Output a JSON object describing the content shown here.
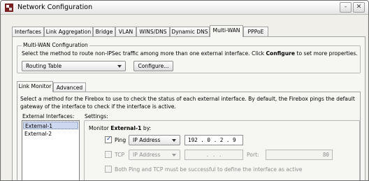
{
  "window": {
    "title": "Network Configuration",
    "controls": {
      "minimize": "-",
      "close": "✕"
    }
  },
  "tabs": [
    {
      "label": "Interfaces"
    },
    {
      "label": "Link Aggregation"
    },
    {
      "label": "Bridge"
    },
    {
      "label": "VLAN"
    },
    {
      "label": "WINS/DNS"
    },
    {
      "label": "Dynamic DNS"
    },
    {
      "label": "Multi-WAN"
    },
    {
      "label": "PPPoE"
    }
  ],
  "active_tab": "Multi-WAN",
  "multiwan": {
    "group_label": "Multi-WAN Configuration",
    "description_pre": "Select the method to route non-IPSec traffic among more than one external interface. Click ",
    "description_bold": "Configure",
    "description_post": " to set more properties.",
    "method_value": "Routing Table",
    "configure_label": "Configure..."
  },
  "subtabs": [
    {
      "label": "Link Monitor"
    },
    {
      "label": "Advanced"
    }
  ],
  "link_monitor": {
    "description": "Select a method for the Firebox to use to check the status of each external interface. By default, the Firebox pings the default",
    "description2": "gateway of the interface to check if the interface is active.",
    "interfaces_label": "External Interfaces:",
    "interfaces": [
      "External-1",
      "External-2"
    ],
    "selected_interface": "External-1",
    "settings_label": "Settings:",
    "monitor_prefix": "Monitor ",
    "monitor_bold": "External-1",
    "monitor_suffix": " by:",
    "ping": {
      "label": "Ping",
      "checked": true,
      "type": "IP Address",
      "value": "192 . 0 . 2 . 9"
    },
    "tcp": {
      "label": "TCP",
      "checked": false,
      "type": "IP Address",
      "value": ". . .",
      "port_label": "Port:",
      "port_value": "80"
    },
    "both_label": "Both Ping and TCP must be successful to define the interface as active"
  }
}
